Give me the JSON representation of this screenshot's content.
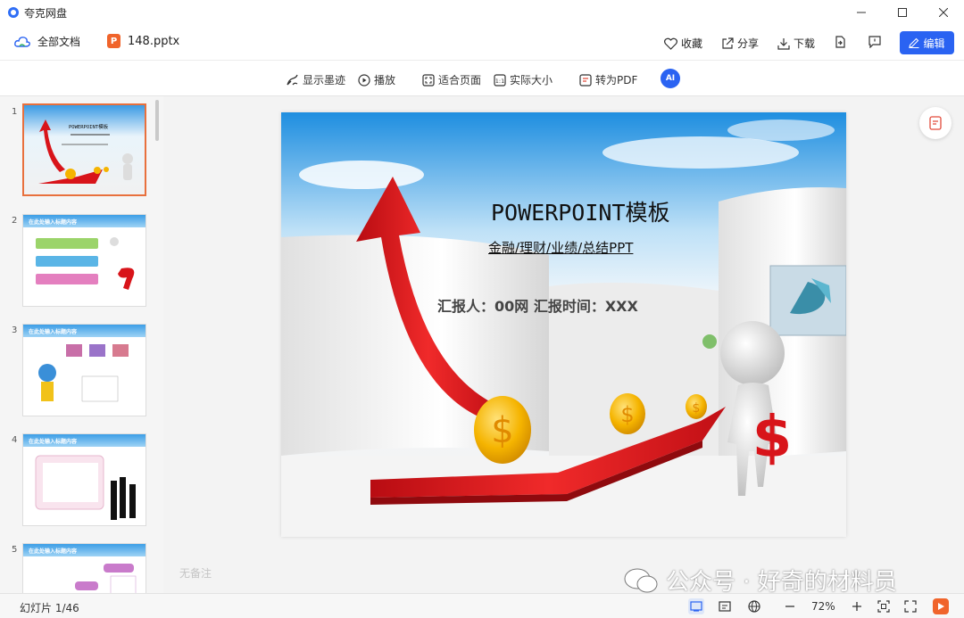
{
  "window": {
    "title": "夸克网盘"
  },
  "appbar": {
    "breadcrumb_root": "全部文档",
    "file_name": "148.pptx",
    "actions": {
      "favorite": "收藏",
      "share": "分享",
      "download": "下载"
    },
    "edit_label": "编辑"
  },
  "toolbar": {
    "show_ink": "显示墨迹",
    "play": "播放",
    "fit_page": "适合页面",
    "actual_size": "实际大小",
    "to_pdf": "转为PDF",
    "ai_label": "AI"
  },
  "thumbnails": [
    {
      "num": "1",
      "active": true,
      "title": "POWERPOINT模板"
    },
    {
      "num": "2",
      "active": false,
      "title": "在此处输入标题内容"
    },
    {
      "num": "3",
      "active": false,
      "title": "在此处输入标题内容"
    },
    {
      "num": "4",
      "active": false,
      "title": "在此处输入标题内容"
    },
    {
      "num": "5",
      "active": false,
      "title": "在此处输入标题内容"
    }
  ],
  "slide": {
    "title": "POWERPOINT模板",
    "subtitle": "金融/理财/业绩/总结PPT",
    "reporter": "汇报人：00网  汇报时间：XXX"
  },
  "notes_placeholder": "无备注",
  "status": {
    "slide_counter": "幻灯片 1/46",
    "zoom": "72%"
  },
  "watermark": "公众号 · 好奇的材料员",
  "colors": {
    "accent": "#2a63f2",
    "active_thumb": "#e8703d",
    "arrow_red": "#d8141a",
    "coin_gold": "#f5b400"
  }
}
